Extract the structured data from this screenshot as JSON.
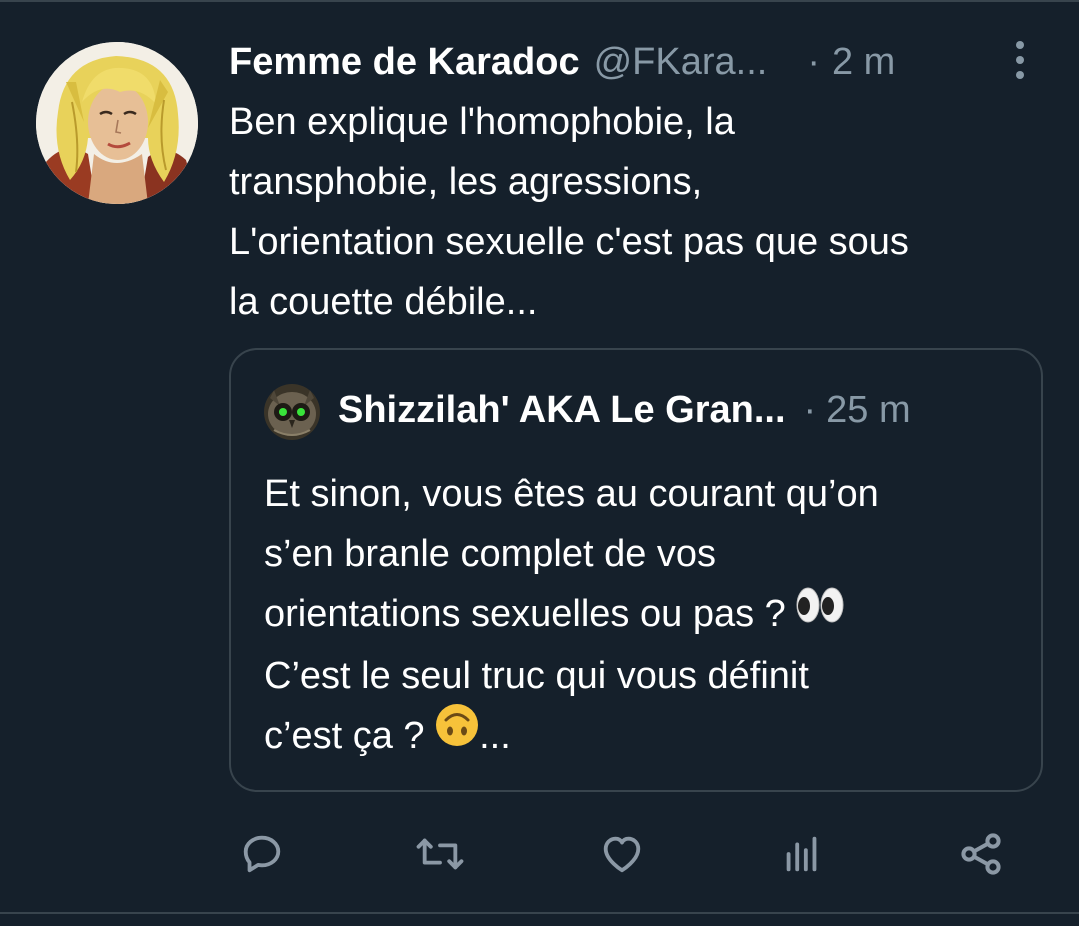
{
  "tweet": {
    "author_name": "Femme de Karadoc",
    "handle": "@FKara...",
    "separator": "·",
    "time": "2 m",
    "text_lines": [
      "Ben explique l'homophobie, la",
      "transphobie, les agressions,",
      "L'orientation sexuelle c'est pas que sous",
      "la couette débile..."
    ]
  },
  "quote": {
    "author_name": "Shizzilah' AKA Le Gran...",
    "separator": "·",
    "time": "25 m",
    "text_lines": [
      "Et sinon, vous êtes au courant qu’on",
      "s’en branle complet de vos",
      "orientations sexuelles ou pas ?",
      "C’est le seul truc qui vous définit",
      "c’est ça ?"
    ],
    "line3_emoji": "eyes",
    "line5_emoji": "upside-down-face",
    "line5_suffix": "..."
  },
  "actions": [
    {
      "name": "reply",
      "icon": "reply-icon"
    },
    {
      "name": "retweet",
      "icon": "retweet-icon"
    },
    {
      "name": "like",
      "icon": "heart-icon"
    },
    {
      "name": "analytics",
      "icon": "analytics-icon"
    },
    {
      "name": "share",
      "icon": "share-icon"
    }
  ],
  "colors": {
    "background": "#15202b",
    "secondary_text": "#8899a6",
    "border": "#38444d",
    "icon": "#8b98a5"
  }
}
